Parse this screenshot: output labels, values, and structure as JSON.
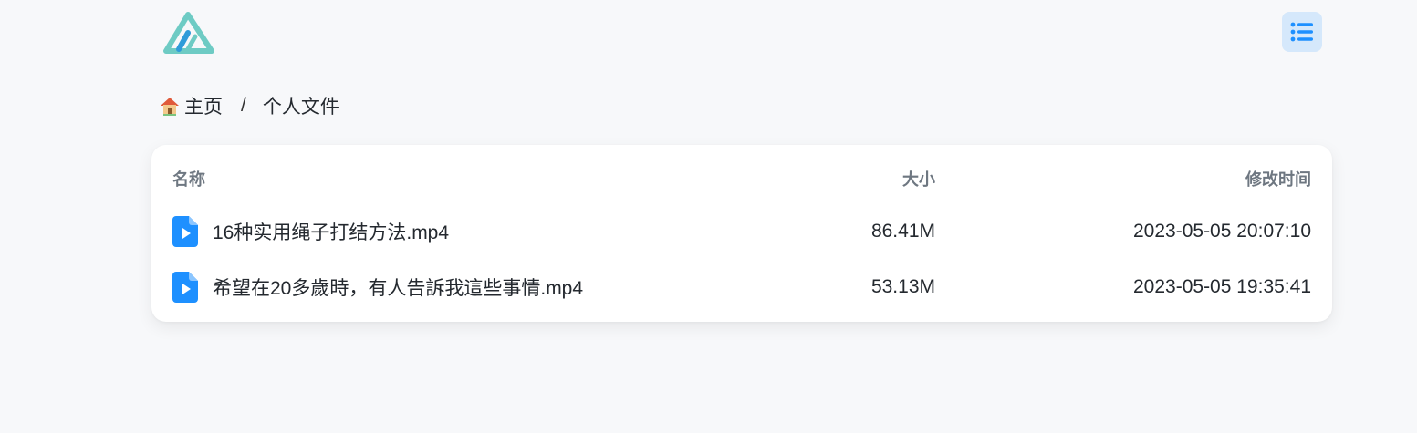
{
  "header": {
    "logo_icon": "app-logo-icon",
    "menu_icon": "list-icon",
    "accent": "#1e90ff",
    "menu_bg": "#d5e8fb"
  },
  "breadcrumb": {
    "home_icon": "house-icon",
    "home_label": "主页",
    "separator": "/",
    "current_label": "个人文件"
  },
  "table": {
    "columns": {
      "name": "名称",
      "size": "大小",
      "modified": "修改时间"
    },
    "rows": [
      {
        "icon": "video-file-icon",
        "name": "16种实用绳子打结方法.mp4",
        "size": "86.41M",
        "modified": "2023-05-05 20:07:10"
      },
      {
        "icon": "video-file-icon",
        "name": "希望在20多歲時，有人告訴我這些事情.mp4",
        "size": "53.13M",
        "modified": "2023-05-05 19:35:41"
      }
    ]
  }
}
